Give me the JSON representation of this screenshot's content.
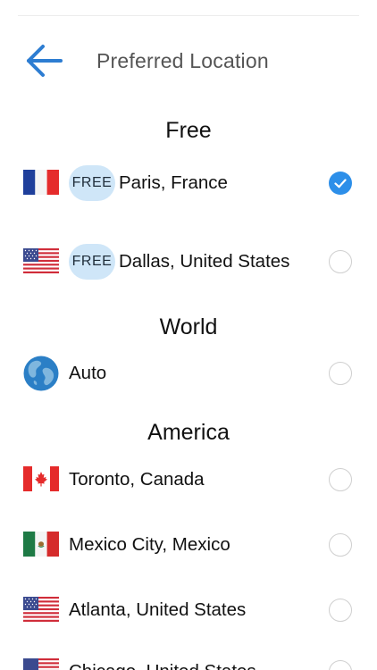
{
  "header": {
    "title": "Preferred Location",
    "back_icon": "arrow-left-icon",
    "accent_color": "#2d7dd2"
  },
  "sections": [
    {
      "title": "Free",
      "items": [
        {
          "badge": "FREE",
          "label": "Paris, France",
          "flag": "france-flag-icon",
          "selected": true
        },
        {
          "badge": "FREE",
          "label": "Dallas, United States",
          "flag": "us-flag-icon",
          "selected": false
        }
      ]
    },
    {
      "title": "World",
      "items": [
        {
          "label": "Auto",
          "flag": "globe-icon",
          "selected": false
        }
      ]
    },
    {
      "title": "America",
      "items": [
        {
          "label": "Toronto, Canada",
          "flag": "canada-flag-icon",
          "selected": false
        },
        {
          "label": "Mexico City, Mexico",
          "flag": "mexico-flag-icon",
          "selected": false
        },
        {
          "label": "Atlanta, United States",
          "flag": "us-flag-icon",
          "selected": false
        },
        {
          "label": "Chicago, United States",
          "flag": "us-flag-icon",
          "selected": false
        }
      ]
    }
  ],
  "colors": {
    "badge_bg": "#cfe6f8",
    "radio_selected": "#2d8fe9",
    "radio_border": "#cfcfcf"
  }
}
